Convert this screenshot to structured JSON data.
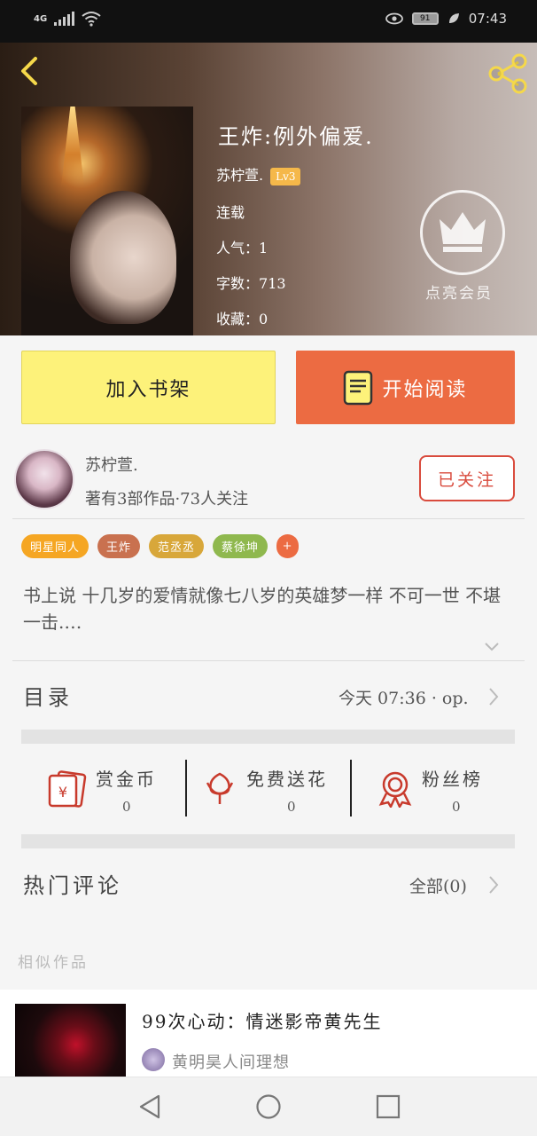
{
  "status_bar": {
    "network": "4G",
    "battery": "91",
    "time": "07:43"
  },
  "book": {
    "title": "王炸:例外偏爱.",
    "author": "苏柠萱.",
    "level": "Lv3",
    "status": "连载",
    "popularity_label": "人气：",
    "popularity": "1",
    "word_count_label": "字数：",
    "word_count": "713",
    "favorites_label": "收藏：",
    "favorites": "0"
  },
  "vip": {
    "label": "点亮会员"
  },
  "actions": {
    "add_shelf": "加入书架",
    "start_reading": "开始阅读"
  },
  "author_card": {
    "name": "苏柠萱.",
    "stats": "著有3部作品·73人关注",
    "follow_label": "已关注"
  },
  "tags": [
    {
      "label": "明星同人",
      "color": "#f5a623"
    },
    {
      "label": "王炸",
      "color": "#c9714f"
    },
    {
      "label": "范丞丞",
      "color": "#d8a73a"
    },
    {
      "label": "蔡徐坤",
      "color": "#8fb84e"
    }
  ],
  "tag_more": "+",
  "description": "书上说 十几岁的爱情就像七八岁的英雄梦一样 不可一世 不堪一击.…",
  "catalog": {
    "label": "目录",
    "latest": "今天 07:36 · op."
  },
  "stats": [
    {
      "label": "赏金币",
      "value": "0",
      "icon": "reward-coin-icon"
    },
    {
      "label": "免费送花",
      "value": "0",
      "icon": "flower-icon"
    },
    {
      "label": "粉丝榜",
      "value": "0",
      "icon": "medal-icon"
    }
  ],
  "comments": {
    "label": "热门评论",
    "all": "全部(0)"
  },
  "similar": {
    "label": "相似作品",
    "items": [
      {
        "title": "99次心动：情迷影帝黄先生",
        "author": "黄明昊人间理想"
      }
    ]
  },
  "colors": {
    "accent": "#ec6b42",
    "shelf": "#fdf27a",
    "follow": "#d94b3d",
    "back_arrow": "#f5d84a"
  }
}
